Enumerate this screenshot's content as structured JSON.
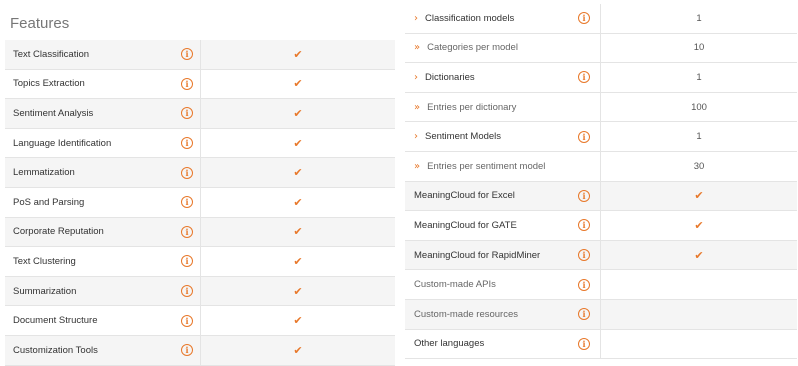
{
  "title": "Features",
  "left_rows": [
    {
      "label": "Text Classification",
      "value": "check"
    },
    {
      "label": "Topics Extraction",
      "value": "check"
    },
    {
      "label": "Sentiment Analysis",
      "value": "check"
    },
    {
      "label": "Language Identification",
      "value": "check"
    },
    {
      "label": "Lemmatization",
      "value": "check"
    },
    {
      "label": "PoS and Parsing",
      "value": "check"
    },
    {
      "label": "Corporate Reputation",
      "value": "check"
    },
    {
      "label": "Text Clustering",
      "value": "check"
    },
    {
      "label": "Summarization",
      "value": "check"
    },
    {
      "label": "Document Structure",
      "value": "check"
    },
    {
      "label": "Customization Tools",
      "value": "check"
    }
  ],
  "right_rows": [
    {
      "label": "Classification models",
      "value": "1"
    },
    {
      "label": "Categories per model",
      "value": "10"
    },
    {
      "label": "Dictionaries",
      "value": "1"
    },
    {
      "label": "Entries per dictionary",
      "value": "100"
    },
    {
      "label": "Sentiment Models",
      "value": "1"
    },
    {
      "label": "Entries per sentiment model",
      "value": "30"
    },
    {
      "label": "MeaningCloud for Excel",
      "value": "check"
    },
    {
      "label": "MeaningCloud for GATE",
      "value": "check"
    },
    {
      "label": "MeaningCloud for RapidMiner",
      "value": "check"
    },
    {
      "label": "Custom-made APIs",
      "value": ""
    },
    {
      "label": "Custom-made resources",
      "value": ""
    },
    {
      "label": "Other languages",
      "value": ""
    }
  ],
  "icons": {
    "info": "info-icon",
    "check": "check-icon",
    "chevron": "chevron-right-icon",
    "double_chevron": "double-chevron-right-icon"
  },
  "colors": {
    "accent": "#e8782a",
    "row_shade": "#f5f5f5"
  }
}
